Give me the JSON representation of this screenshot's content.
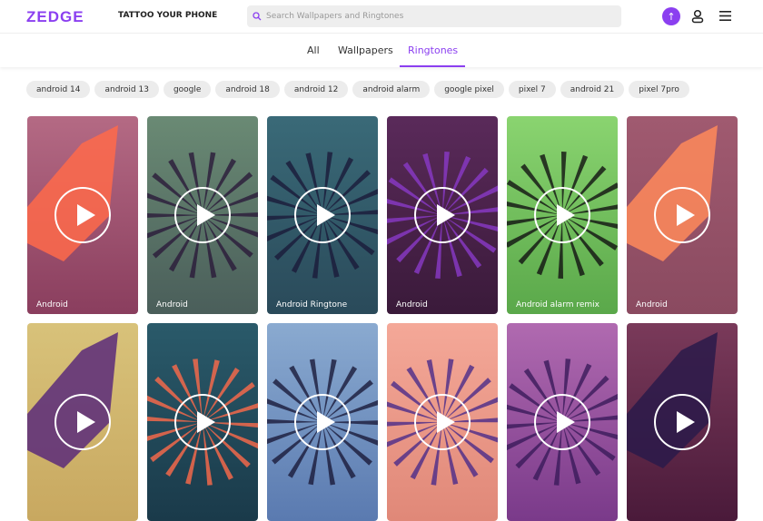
{
  "header": {
    "logo": "ZEDGE",
    "tagline": "TATTOO YOUR PHONE",
    "search_placeholder": "Search Wallpapers and Ringtones"
  },
  "tabs": [
    {
      "label": "All"
    },
    {
      "label": "Wallpapers"
    },
    {
      "label": "Ringtones",
      "active": true
    }
  ],
  "chips": [
    "android 14",
    "android 13",
    "google",
    "android 18",
    "android 12",
    "android alarm",
    "google pixel",
    "pixel 7",
    "android 21",
    "pixel 7pro"
  ],
  "accent": "#8b3ff0",
  "cards": [
    {
      "title": "Android",
      "bg": [
        "#b46a84",
        "#8a3e5e"
      ],
      "shape": "#ff6a4a"
    },
    {
      "title": "Android",
      "bg": [
        "#6a8a74",
        "#4a5e5a"
      ],
      "shape": "#2a1a3a"
    },
    {
      "title": "Android Ringtone",
      "bg": [
        "#3a6a78",
        "#2a4a5a"
      ],
      "shape": "#1a1a3a"
    },
    {
      "title": "Android",
      "bg": [
        "#5a2a5a",
        "#3a1a3a"
      ],
      "shape": "#8a3ac8"
    },
    {
      "title": "Android alarm remix",
      "bg": [
        "#8ad470",
        "#5aa84a"
      ],
      "shape": "#111"
    },
    {
      "title": "Android",
      "bg": [
        "#a05a70",
        "#8a4a60"
      ],
      "shape": "#ff8a5a"
    },
    {
      "title": "",
      "bg": [
        "#d8c27a",
        "#c8a860"
      ],
      "shape": "#5a2a7a"
    },
    {
      "title": "",
      "bg": [
        "#2a5a6a",
        "#1a3a4a"
      ],
      "shape": "#ff6a4a"
    },
    {
      "title": "",
      "bg": [
        "#8aaad0",
        "#5a7ab0"
      ],
      "shape": "#1a1a3a"
    },
    {
      "title": "",
      "bg": [
        "#f4a898",
        "#e08878"
      ],
      "shape": "#4a2a8a"
    },
    {
      "title": "",
      "bg": [
        "#b06ab0",
        "#7a3a8a"
      ],
      "shape": "#3a1a5a"
    },
    {
      "title": "",
      "bg": [
        "#7a3a5a",
        "#4a1a3a"
      ],
      "shape": "#2a1a4a"
    }
  ]
}
